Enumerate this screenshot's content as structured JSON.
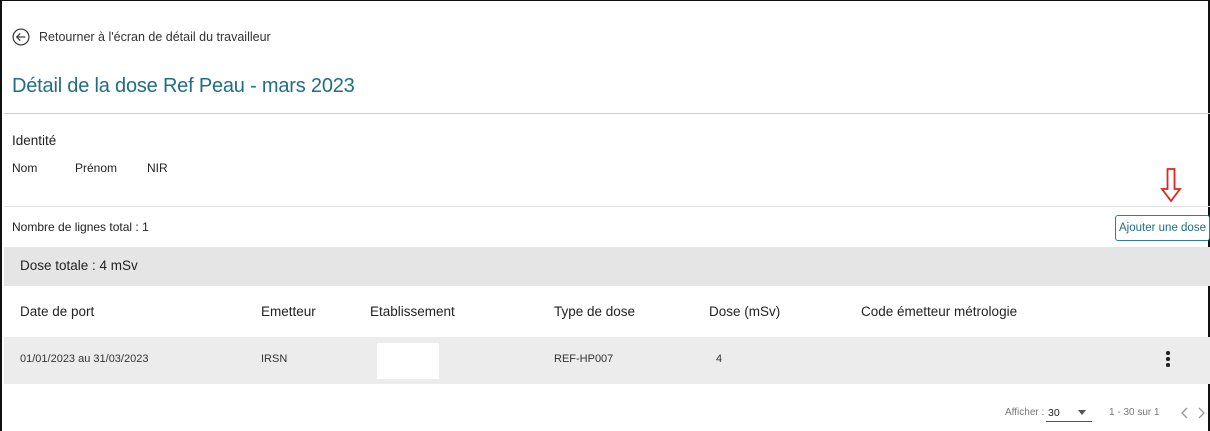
{
  "header": {
    "back_label": "Retourner à l'écran de détail du travailleur",
    "title": "Détail de la dose Ref Peau - mars 2023"
  },
  "identity": {
    "title": "Identité",
    "fields": [
      "Nom",
      "Prénom",
      "NIR"
    ]
  },
  "summary": {
    "rows_total": "Nombre de lignes total : 1",
    "add_button": "Ajouter une dose",
    "dose_total": "Dose totale : 4 mSv"
  },
  "table": {
    "columns": [
      "Date de port",
      "Emetteur",
      "Etablissement",
      "Type de dose",
      "Dose (mSv)",
      "Code émetteur métrologie"
    ],
    "rows": [
      {
        "date": "01/01/2023 au 31/03/2023",
        "emetteur": "IRSN",
        "etablissement": "",
        "type": "REF-HP007",
        "dose": "4",
        "code": ""
      }
    ]
  },
  "pagination": {
    "show_label": "Afficher :",
    "page_size": "30",
    "range": "1 - 30 sur 1"
  },
  "colors": {
    "accent": "#1f6e86",
    "annotation_arrow": "#e0261f",
    "band": "#e5e5e5"
  },
  "icons": {
    "back": "arrow-left-circle-icon",
    "annotation": "down-arrow-icon",
    "row_menu": "kebab-menu-icon",
    "prev": "chevron-left-icon",
    "next": "chevron-right-icon"
  }
}
